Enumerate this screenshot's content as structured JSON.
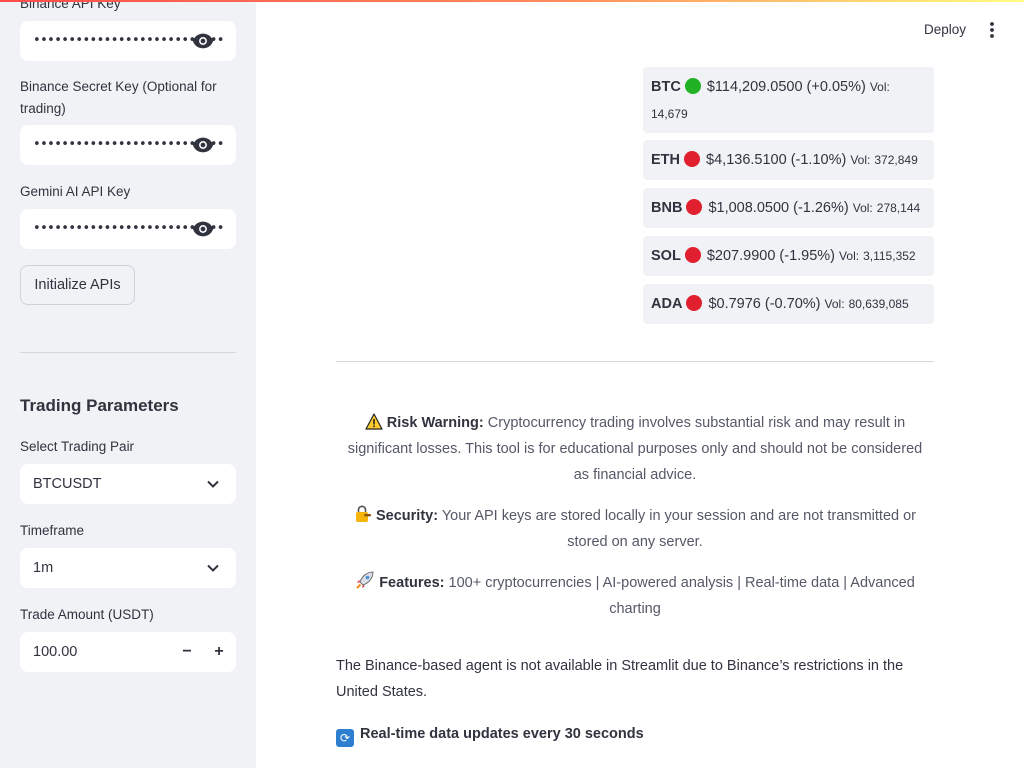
{
  "sidebar": {
    "binance_api_key": {
      "label": "Binance API Key",
      "value": "•••••••••••••••••••••••••••"
    },
    "binance_secret_key": {
      "label": "Binance Secret Key (Optional for trading)",
      "value": "•••••••••••••••••••••••••••"
    },
    "gemini_api_key": {
      "label": "Gemini AI API Key",
      "value": "•••••••••••••••••••••••••••"
    },
    "initialize_button": "Initialize APIs",
    "trading_params_heading": "Trading Parameters",
    "trading_pair": {
      "label": "Select Trading Pair",
      "value": "BTCUSDT"
    },
    "timeframe": {
      "label": "Timeframe",
      "value": "1m"
    },
    "trade_amount": {
      "label": "Trade Amount (USDT)",
      "value": "100.00",
      "minus": "−",
      "plus": "+"
    }
  },
  "header": {
    "deploy_label": "Deploy"
  },
  "market": [
    {
      "symbol": "BTC",
      "status_color": "#21b323",
      "price": "$114,209.0500 (+0.05%)",
      "vol_label": "Vol:",
      "vol_value": "14,679"
    },
    {
      "symbol": "ETH",
      "status_color": "#e0202e",
      "price": "$4,136.5100 (-1.10%)",
      "vol_label": "Vol:",
      "vol_value": "372,849"
    },
    {
      "symbol": "BNB",
      "status_color": "#e0202e",
      "price": "$1,008.0500 (-1.26%)",
      "vol_label": "Vol:",
      "vol_value": "278,144"
    },
    {
      "symbol": "SOL",
      "status_color": "#e0202e",
      "price": "$207.9900 (-1.95%)",
      "vol_label": "Vol:",
      "vol_value": "3,115,352"
    },
    {
      "symbol": "ADA",
      "status_color": "#e0202e",
      "price": "$0.7976 (-0.70%)",
      "vol_label": "Vol:",
      "vol_value": "80,639,085"
    }
  ],
  "notes": {
    "risk": {
      "icon": "warning-icon",
      "title": "Risk Warning:",
      "text": " Cryptocurrency trading involves substantial risk and may result in significant losses. This tool is for educational purposes only and should not be considered as financial advice."
    },
    "security": {
      "icon": "lock-key-icon",
      "title": "Security:",
      "text": " Your API keys are stored locally in your session and are not transmitted or stored on any server."
    },
    "features": {
      "icon": "rocket-icon",
      "title": "Features:",
      "text": " 100+ cryptocurrencies | AI-powered analysis | Real-time data | Advanced charting"
    }
  },
  "availability_text": "The Binance-based agent is not available in Streamlit due to Binance’s restrictions in the United States.",
  "realtime_text": "Real-time data updates every 30 seconds",
  "colors": {
    "accent": "#ff4b4b",
    "sidebar_bg": "#f0f2f6",
    "up": "#21b323",
    "down": "#e0202e"
  }
}
